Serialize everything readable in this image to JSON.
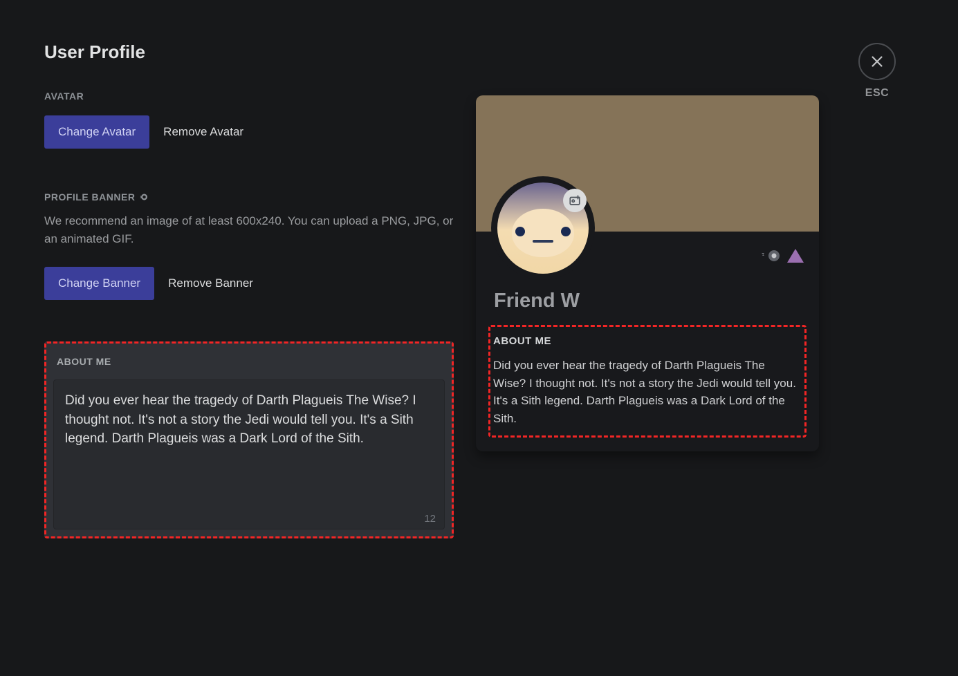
{
  "page": {
    "title": "User Profile"
  },
  "close": {
    "label": "ESC"
  },
  "avatar_section": {
    "label": "AVATAR",
    "change_btn": "Change Avatar",
    "remove_btn": "Remove Avatar"
  },
  "banner_section": {
    "label": "PROFILE BANNER",
    "description": "We recommend an image of at least 600x240. You can upload a PNG, JPG, or an animated GIF.",
    "change_btn": "Change Banner",
    "remove_btn": "Remove Banner"
  },
  "about_editor": {
    "label": "ABOUT ME",
    "text": "Did you ever hear the tragedy of Darth Plagueis The Wise? I thought not. It's not a story the Jedi would tell you. It's a Sith legend. Darth Plagueis was a Dark Lord of the Sith.",
    "char_count": "12"
  },
  "preview": {
    "username": "Friend W",
    "about_label": "ABOUT ME",
    "about_text": "Did you ever hear the tragedy of Darth Plagueis The Wise? I thought not. It's not a story the Jedi would tell you. It's a Sith legend. Darth Plagueis was a Dark Lord of the Sith."
  },
  "colors": {
    "banner": "#857358",
    "accent": "#3b3e9a",
    "highlight": "#f22525"
  }
}
